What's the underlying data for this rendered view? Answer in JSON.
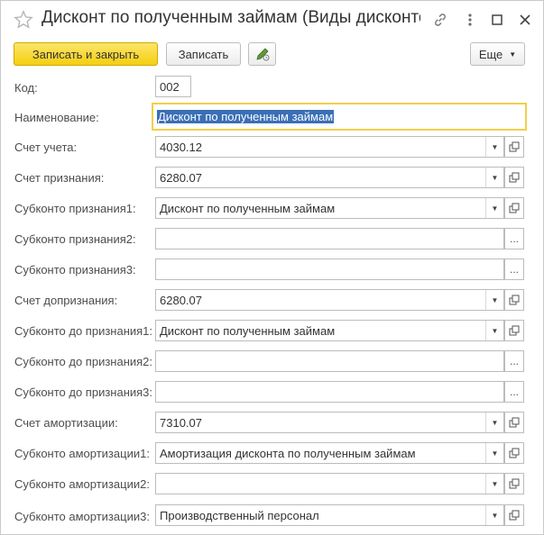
{
  "window": {
    "title": "Дисконт по полученным займам (Виды дисконто..."
  },
  "toolbar": {
    "write_close_label": "Записать и закрыть",
    "write_label": "Записать",
    "more_label": "Еще"
  },
  "form": {
    "code": {
      "label": "Код:",
      "value": "002"
    },
    "name": {
      "label": "Наименование:",
      "value": "Дисконт по полученным займам"
    },
    "rows": [
      {
        "label": "Счет учета:",
        "value": "4030.12"
      },
      {
        "label": "Счет признания:",
        "value": "6280.07"
      },
      {
        "label": "Субконто признания1:",
        "value": "Дисконт по полученным займам"
      },
      {
        "label": "Субконто признания2:",
        "value": ""
      },
      {
        "label": "Субконто признания3:",
        "value": ""
      },
      {
        "label": "Счет допризнания:",
        "value": "6280.07"
      },
      {
        "label": "Субконто до признания1:",
        "value": "Дисконт по полученным займам"
      },
      {
        "label": "Субконто до признания2:",
        "value": ""
      },
      {
        "label": "Субконто до признания3:",
        "value": ""
      },
      {
        "label": "Счет амортизации:",
        "value": "7310.07"
      },
      {
        "label": "Субконто амортизации1:",
        "value": "Амортизация дисконта по полученным займам"
      },
      {
        "label": "Субконто амортизации2:",
        "value": ""
      },
      {
        "label": "Субконто амортизации3:",
        "value": "Производственный персонал"
      }
    ]
  },
  "colors": {
    "primary_button": "#f4cf0f",
    "focus_border": "#f2cf4a",
    "selection": "#3a6fb7"
  }
}
